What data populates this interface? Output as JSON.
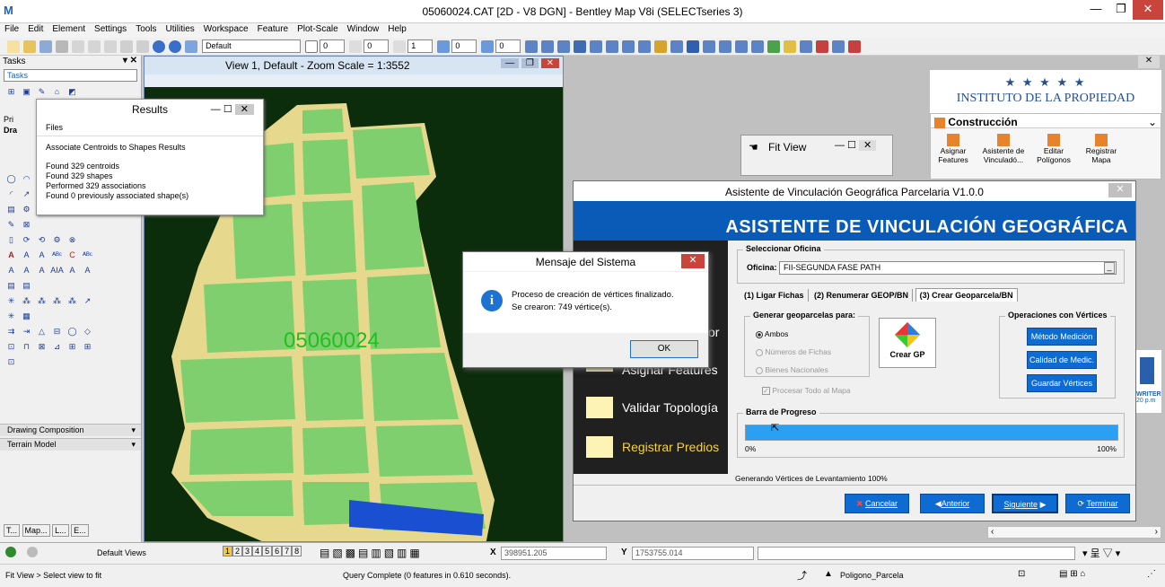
{
  "app": {
    "title": "05060024.CAT [2D - V8 DGN] - Bentley Map V8i (SELECTseries 3)"
  },
  "menu": [
    "File",
    "Edit",
    "Element",
    "Settings",
    "Tools",
    "Utilities",
    "Workspace",
    "Feature",
    "Plot-Scale",
    "Window",
    "Help"
  ],
  "toolbar": {
    "level_combo": "Default",
    "weights": [
      "0",
      "0",
      "1",
      "0",
      "0"
    ]
  },
  "tasks": {
    "header": "Tasks",
    "combo": "Tasks",
    "tool_labels": [
      "Pri",
      "Dra"
    ],
    "sections": [
      "Drawing Composition",
      "Terrain Model"
    ],
    "bottom_tabs": [
      "T...",
      "Map...",
      "L...",
      "E..."
    ]
  },
  "view": {
    "title": "View 1, Default - Zoom Scale = 1:3552",
    "map_label": "05060024"
  },
  "results": {
    "title": "Results",
    "tab": "Files",
    "heading": "Associate Centroids to Shapes Results",
    "lines": [
      "Found 329 centroids",
      "Found 329 shapes",
      "Performed 329 associations",
      "Found 0 previously associated shape(s)"
    ]
  },
  "fitview": {
    "title": "Fit View"
  },
  "institute": {
    "stars": "★ ★ ★ ★ ★",
    "name": "INSTITUTO DE LA PROPIEDAD"
  },
  "construccion": {
    "title": "Construcción",
    "items": [
      {
        "l1": "Asignar",
        "l2": "Features"
      },
      {
        "l1": "Asistente de",
        "l2": "Vinculadó..."
      },
      {
        "l1": "Editar",
        "l2": "Polígonos"
      },
      {
        "l1": "Registrar",
        "l2": "Mapa"
      }
    ]
  },
  "wizard": {
    "title": "Asistente de Vinculación Geográfica Parcelaria V1.0.0",
    "banner": "ASISTENTE DE VINCULACIÓN GEOGRÁFICA",
    "steps": [
      "or",
      "Asignar Features",
      "Validar Topología",
      "Registrar Predios"
    ],
    "office_legend": "Seleccionar Oficina",
    "office_label": "Oficina:",
    "office_value": "FII-SEGUNDA FASE PATH",
    "tabs": [
      "(1) Ligar Fichas",
      "(2) Renumerar GEOP/BN",
      "(3) Crear Geoparcela/BN"
    ],
    "gen_legend": "Generar geoparcelas para:",
    "radios": [
      "Ambos",
      "Números de Fichas",
      "Bienes Nacionales"
    ],
    "check_label": "Procesar Todo al Mapa",
    "crear_gp": "Crear GP",
    "ops_legend": "Operaciones con Vértices",
    "ops_buttons": [
      "Método Medición",
      "Calidad de Medic.",
      "Guardar Vértices"
    ],
    "progress_legend": "Barra de Progreso",
    "progress_min": "0%",
    "progress_max": "100%",
    "progress_value": 100,
    "status": "Generando Vértices de Levantamiento 100%",
    "nav": [
      "Cancelar",
      "Anterior",
      "Siguiente",
      "Terminar"
    ]
  },
  "msgbox": {
    "title": "Mensaje del Sistema",
    "line1": "Proceso de creación de vértices finalizado.",
    "line2": "Se crearon:  749 vértice(s).",
    "ok": "OK"
  },
  "coords": {
    "views_label": "Default Views",
    "view_numbers": [
      "1",
      "2",
      "3",
      "4",
      "5",
      "6",
      "7",
      "8"
    ],
    "x_label": "X",
    "x_value": "398951.205",
    "y_label": "Y",
    "y_value": "1753755.014"
  },
  "status": {
    "left": "Fit View > Select view to fit",
    "middle": "Query Complete (0 features in 0.610 seconds).",
    "feature": "Poligono_Parcela",
    "right_partial": "WRITER",
    "time_partial": "20 p.m"
  },
  "colors": {
    "parcel": "#7fcf6f",
    "road": "#e6d98e",
    "banner": "#0a5ab8",
    "progress": "#2b9ff2",
    "map_bg": "#0c2d0c"
  }
}
